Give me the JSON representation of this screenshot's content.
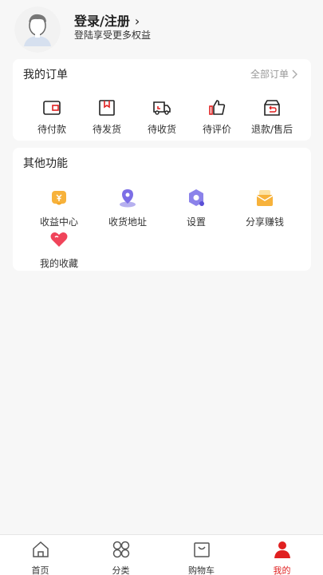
{
  "user": {
    "login_title": "登录/注册",
    "login_subtitle": "登陆享受更多权益"
  },
  "orders": {
    "title": "我的订单",
    "all_label": "全部订单",
    "items": [
      {
        "label": "待付款",
        "icon": "wallet-icon"
      },
      {
        "label": "待发货",
        "icon": "package-icon"
      },
      {
        "label": "待收货",
        "icon": "truck-icon"
      },
      {
        "label": "待评价",
        "icon": "thumbs-up-icon"
      },
      {
        "label": "退款/售后",
        "icon": "return-box-icon"
      }
    ]
  },
  "functions": {
    "title": "其他功能",
    "items": [
      {
        "label": "收益中心",
        "icon": "income-icon"
      },
      {
        "label": "收货地址",
        "icon": "location-icon"
      },
      {
        "label": "设置",
        "icon": "settings-icon"
      },
      {
        "label": "分享赚钱",
        "icon": "share-money-icon"
      },
      {
        "label": "我的收藏",
        "icon": "heart-icon"
      }
    ]
  },
  "tabbar": {
    "items": [
      {
        "label": "首页",
        "icon": "home-icon"
      },
      {
        "label": "分类",
        "icon": "category-icon"
      },
      {
        "label": "购物车",
        "icon": "cart-icon"
      },
      {
        "label": "我的",
        "icon": "user-icon",
        "active": true
      }
    ]
  },
  "colors": {
    "accent": "#e02020",
    "background": "#f7f7f7"
  }
}
